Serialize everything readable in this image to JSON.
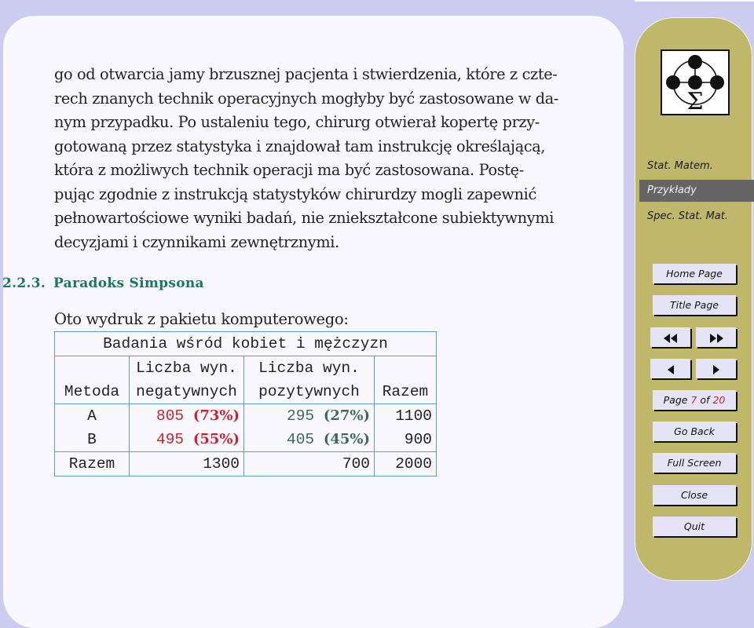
{
  "document": {
    "paragraph_lines": [
      "go od otwarcia jamy brzusznej pacjenta i stwierdzenia, które z czte-",
      "rech znanych technik operacyjnych mogłyby być zastosowane w da-",
      "nym przypadku. Po ustaleniu tego, chirurg otwierał kopertę przy-",
      "gotowaną przez statystyka i znajdował tam instrukcję określającą,",
      "która z możliwych technik operacji ma być zastosowana. Postę-",
      "pując zgodnie z instrukcją statystyków chirurdzy mogli zapewnić",
      "pełnowartościowe wyniki badań, nie zniekształcone subiektywnymi",
      "decyzjami i czynnikami zewnętrznymi."
    ],
    "section": {
      "number": "2.2.3.",
      "title": "Paradoks Simpsona"
    },
    "intro": "Oto wydruk z pakietu komputerowego:",
    "table": {
      "title": "Badania wśród kobiet i mężczyzn",
      "header_row1": [
        "",
        "Liczba wyn.",
        "Liczba wyn.",
        ""
      ],
      "header_row2": [
        "Metoda",
        "negatywnych",
        "pozytywnych",
        "Razem"
      ],
      "rows": [
        {
          "metoda": "A",
          "neg_count": "805",
          "neg_pct": "(73%)",
          "pos_count": "295",
          "pos_pct": "(27%)",
          "razem": "1100"
        },
        {
          "metoda": "B",
          "neg_count": "495",
          "neg_pct": "(55%)",
          "pos_count": "405",
          "pos_pct": "(45%)",
          "razem": "900"
        }
      ],
      "total": {
        "label": "Razem",
        "neg": "1300",
        "pos": "700",
        "razem": "2000"
      }
    }
  },
  "sidebar": {
    "logo_icon": "statistics-sigma-logo",
    "nav": [
      {
        "label": "Stat. Matem.",
        "active": false
      },
      {
        "label": "Przykłady",
        "active": true
      },
      {
        "label": "Spec. Stat. Mat.",
        "active": false
      }
    ],
    "buttons": {
      "home": "Home Page",
      "title": "Title Page",
      "first_icon": "double-left-arrow",
      "last_icon": "double-right-arrow",
      "prev_icon": "left-arrow",
      "next_icon": "right-arrow",
      "go_back": "Go Back",
      "full_screen": "Full Screen",
      "close": "Close",
      "quit": "Quit"
    },
    "page_indicator": {
      "prefix": "Page",
      "current": "7",
      "of": "of",
      "total": "20"
    }
  },
  "colors": {
    "background": "#ccccf0",
    "panel": "#f8f8fe",
    "sidebar": "#bfb86b",
    "heading": "#1b7560",
    "negative": "#c8242e",
    "positive": "#3e6a58",
    "table_border": "#5b9bd0",
    "button": "#e4e4f6"
  }
}
